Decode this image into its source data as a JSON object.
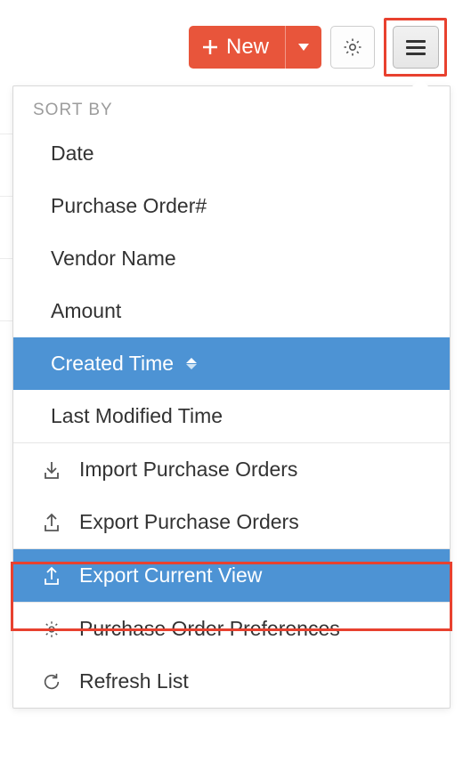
{
  "toolbar": {
    "new_label": "New"
  },
  "dropdown": {
    "sort_by_label": "SORT BY",
    "sort_options": [
      {
        "label": "Date"
      },
      {
        "label": "Purchase Order#"
      },
      {
        "label": "Vendor Name"
      },
      {
        "label": "Amount"
      },
      {
        "label": "Created Time",
        "selected": true
      },
      {
        "label": "Last Modified Time"
      }
    ],
    "actions": [
      {
        "label": "Import Purchase Orders",
        "icon": "import"
      },
      {
        "label": "Export Purchase Orders",
        "icon": "export"
      },
      {
        "label": "Export Current View",
        "icon": "export",
        "selected": true
      },
      {
        "label": "Purchase Order Preferences",
        "icon": "gear"
      },
      {
        "label": "Refresh List",
        "icon": "refresh"
      }
    ]
  },
  "colors": {
    "primary": "#e8553b",
    "highlight": "#4d93d4",
    "callout": "#e8412f"
  }
}
